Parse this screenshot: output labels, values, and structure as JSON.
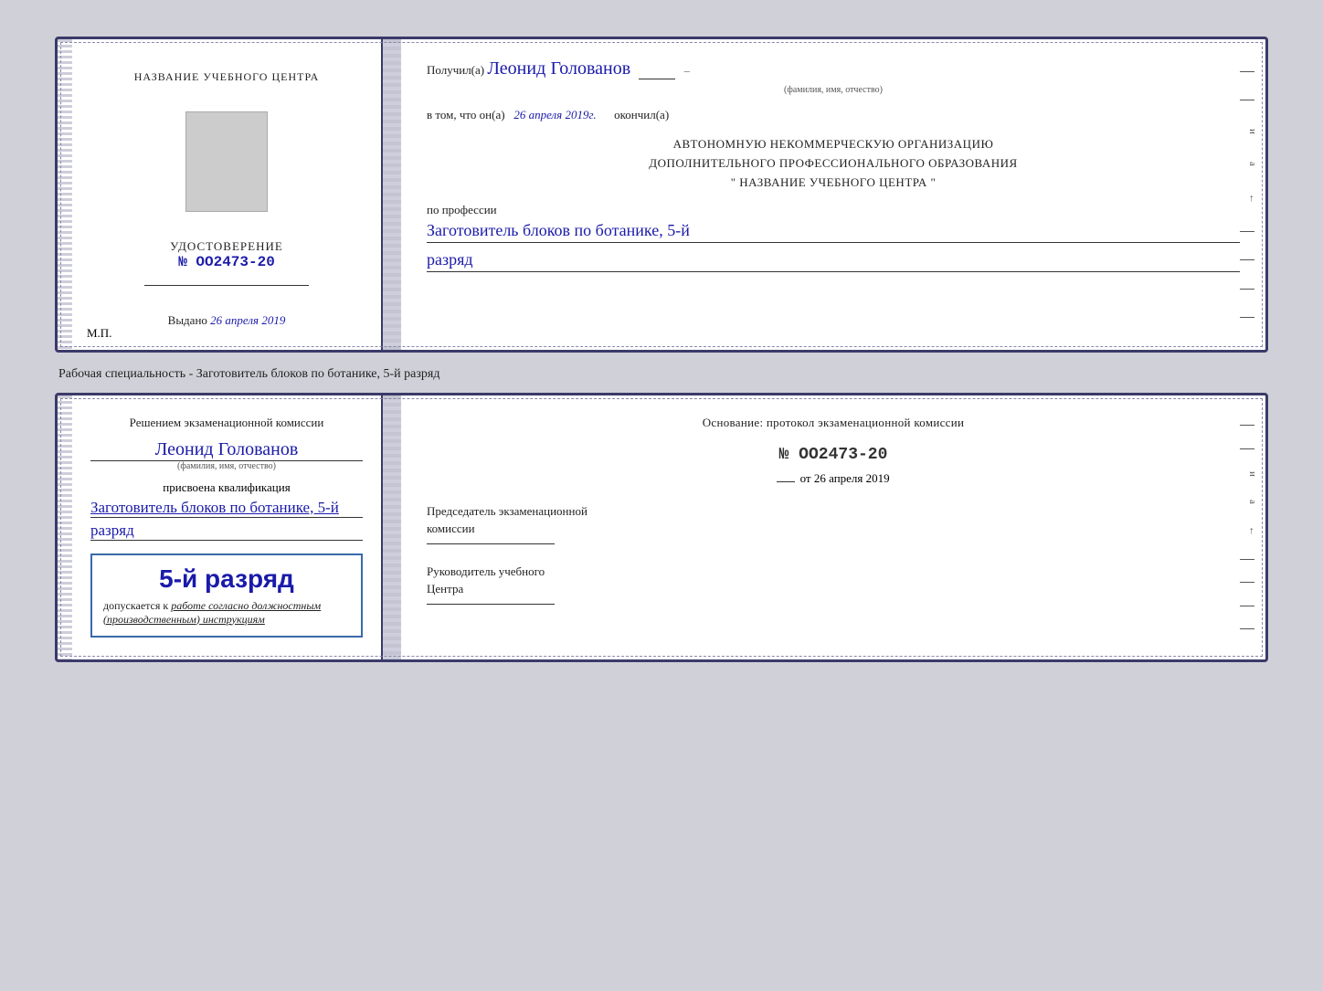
{
  "card1": {
    "left": {
      "title": "НАЗВАНИЕ УЧЕБНОГО ЦЕНТРА",
      "udostoverenie_label": "УДОСТОВЕРЕНИЕ",
      "number": "№ OO2473-20",
      "vydano_label": "Выдано",
      "vydano_date": "26 апреля 2019",
      "mp_label": "М.П."
    },
    "right": {
      "poluchil_prefix": "Получил(а)",
      "person_name": "Леонид Голованов",
      "fio_label": "(фамилия, имя, отчество)",
      "vtom_text": "в том, что он(а)",
      "date_value": "26 апреля 2019г.",
      "okончил_suffix": "окончил(а)",
      "auto_line1": "АВТОНОМНУЮ НЕКОММЕРЧЕСКУЮ ОРГАНИЗАЦИЮ",
      "auto_line2": "ДОПОЛНИТЕЛЬНОГО ПРОФЕССИОНАЛЬНОГО ОБРАЗОВАНИЯ",
      "auto_line3": "\"  НАЗВАНИЕ УЧЕБНОГО ЦЕНТРА  \"",
      "po_professii": "по профессии",
      "profession_name": "Заготовитель блоков по ботанике, 5-й",
      "razryad": "разряд"
    }
  },
  "speciality_label": "Рабочая специальность - Заготовитель блоков по ботанике, 5-й разряд",
  "card2": {
    "left": {
      "resheniyem_line1": "Решением экзаменационной комиссии",
      "person_name": "Леонид Голованов",
      "fio_label": "(фамилия, имя, отчество)",
      "prisvoyena": "присвоена квалификация",
      "profession_name": "Заготовитель блоков по ботанике, 5-й",
      "razryad": "разряд",
      "stamp_razryad": "5-й разряд",
      "dopuskaetsya": "допускается к",
      "rabote_italic": "работе согласно должностным",
      "instruktsiyam": "(производственным) инструкциям"
    },
    "right": {
      "osnovanie_line1": "Основание: протокол экзаменационной комиссии",
      "protocol_number": "№  OO2473-20",
      "ot_label": "от",
      "ot_date": "26 апреля 2019",
      "chairman_line1": "Председатель экзаменационной",
      "chairman_line2": "комиссии",
      "ruk_line1": "Руководитель учебного",
      "ruk_line2": "Центра"
    }
  }
}
